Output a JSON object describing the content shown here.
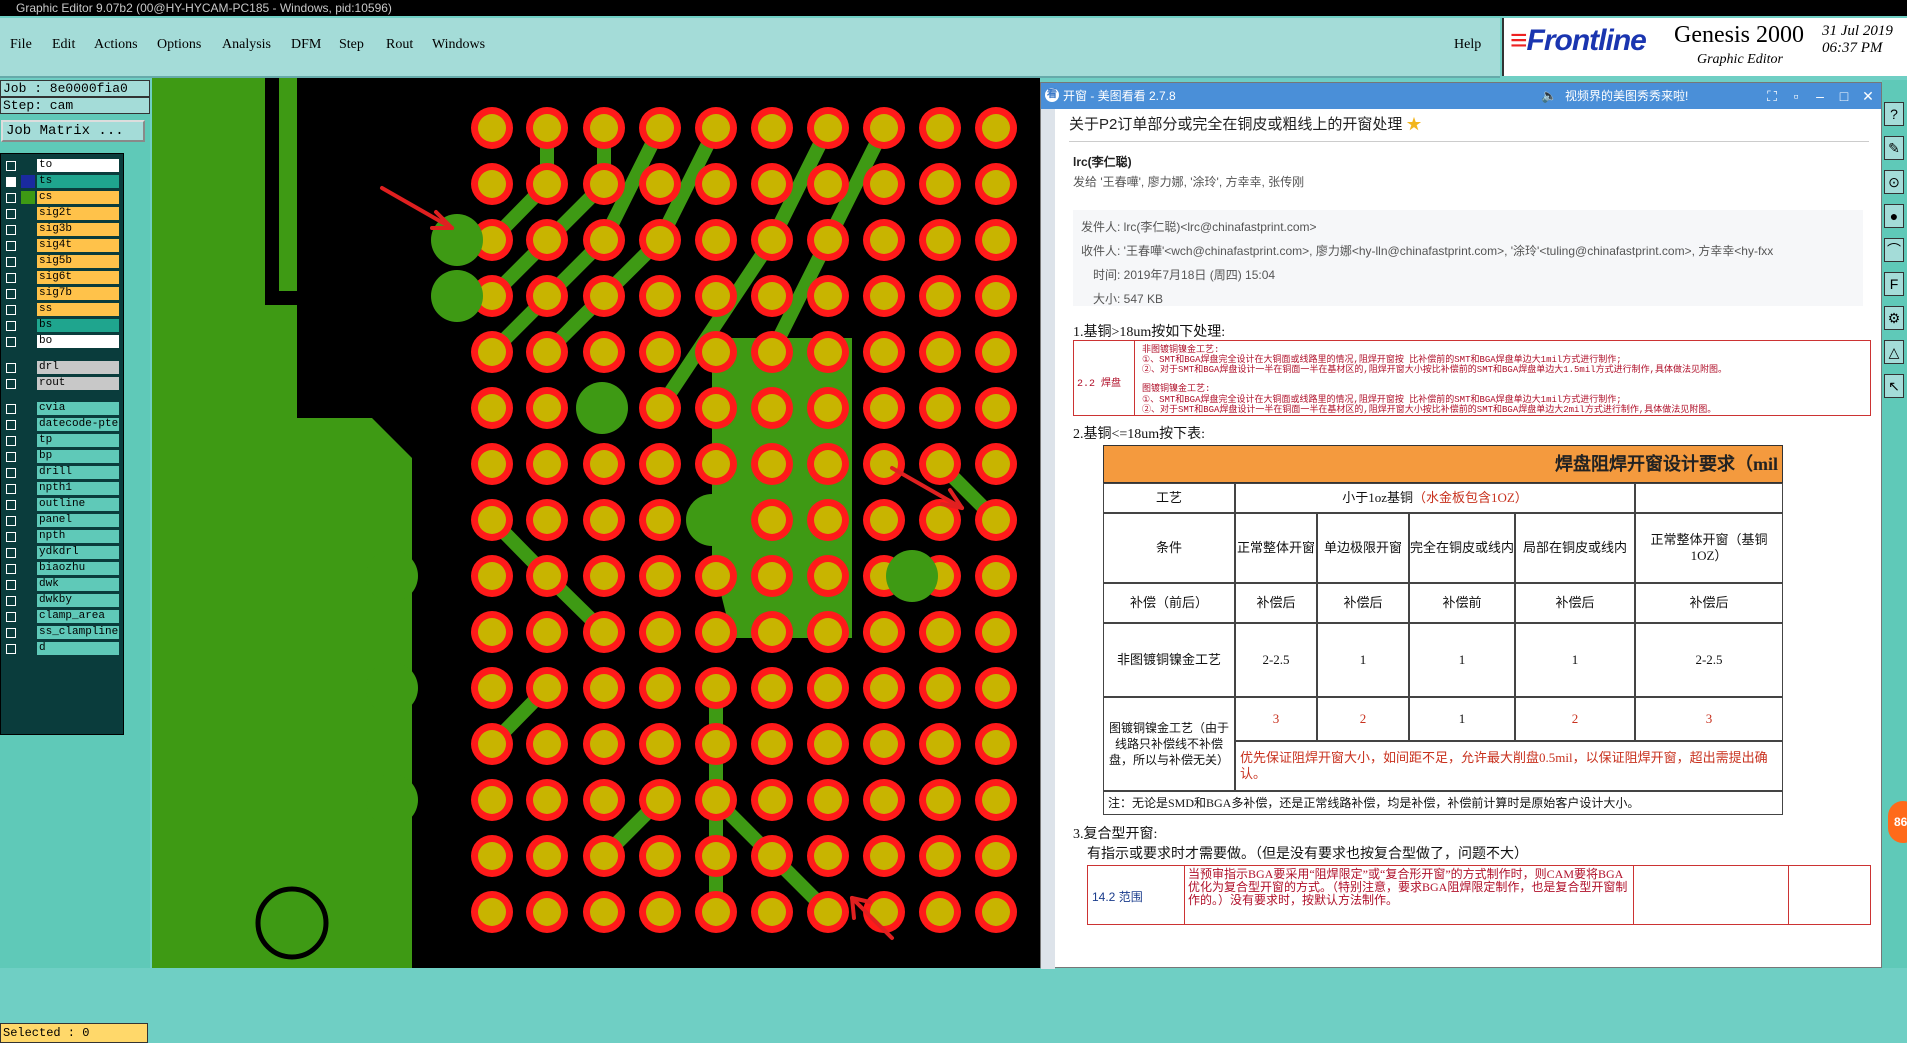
{
  "window_title": "Graphic Editor 9.07b2 (00@HY-HYCAM-PC185 - Windows, pid:10596)",
  "menu": [
    "File",
    "Edit",
    "Actions",
    "Options",
    "Analysis",
    "DFM",
    "Step",
    "Rout",
    "Windows"
  ],
  "help_label": "Help",
  "brand": {
    "logo": "Frontline",
    "product": "Genesis 2000",
    "subtitle": "Graphic Editor",
    "date": "31 Jul 2019",
    "time": "06:37 PM"
  },
  "job_label": "Job : 8e0000fia0",
  "step_label": "Step: cam",
  "job_matrix_label": "Job Matrix ...",
  "layers": [
    {
      "name": "to",
      "color": "#ffffff",
      "row": 0
    },
    {
      "name": "ts",
      "color": "#1fa58e",
      "row": 1
    },
    {
      "name": "cs",
      "color": "#ffc24a",
      "row": 2
    },
    {
      "name": "sig2t",
      "color": "#ffc24a",
      "row": 3
    },
    {
      "name": "sig3b",
      "color": "#ffc24a",
      "row": 4
    },
    {
      "name": "sig4t",
      "color": "#ffc24a",
      "row": 5
    },
    {
      "name": "sig5b",
      "color": "#ffc24a",
      "row": 6
    },
    {
      "name": "sig6t",
      "color": "#ffc24a",
      "row": 7
    },
    {
      "name": "sig7b",
      "color": "#ffc24a",
      "row": 8
    },
    {
      "name": "ss",
      "color": "#ffc24a",
      "row": 9
    },
    {
      "name": "bs",
      "color": "#1fa58e",
      "row": 10
    },
    {
      "name": "bo",
      "color": "#ffffff",
      "row": 11
    },
    {
      "name": "drl",
      "color": "#c8c8c8",
      "row": 12.6
    },
    {
      "name": "rout",
      "color": "#c8c8c8",
      "row": 13.6
    },
    {
      "name": "cvia",
      "color": "#5fc9b8",
      "row": 15.2
    },
    {
      "name": "datecode-pte",
      "color": "#5fc9b8",
      "row": 16.2
    },
    {
      "name": "tp",
      "color": "#5fc9b8",
      "row": 17.2
    },
    {
      "name": "bp",
      "color": "#5fc9b8",
      "row": 18.2
    },
    {
      "name": "drill",
      "color": "#5fc9b8",
      "row": 19.2
    },
    {
      "name": "npth1",
      "color": "#5fc9b8",
      "row": 20.2
    },
    {
      "name": "outline",
      "color": "#5fc9b8",
      "row": 21.2
    },
    {
      "name": "panel",
      "color": "#5fc9b8",
      "row": 22.2
    },
    {
      "name": "npth",
      "color": "#5fc9b8",
      "row": 23.2
    },
    {
      "name": "ydkdrl",
      "color": "#5fc9b8",
      "row": 24.2
    },
    {
      "name": "biaozhu",
      "color": "#5fc9b8",
      "row": 25.2
    },
    {
      "name": "dwk",
      "color": "#5fc9b8",
      "row": 26.2
    },
    {
      "name": "dwkby",
      "color": "#5fc9b8",
      "row": 27.2
    },
    {
      "name": "clamp_area",
      "color": "#5fc9b8",
      "row": 28.2
    },
    {
      "name": "ss_clampline",
      "color": "#5fc9b8",
      "row": 29.2
    },
    {
      "name": "d",
      "color": "#5fc9b8",
      "row": 30.2
    }
  ],
  "selected_label": "Selected : 0",
  "viewer": {
    "title": "开窗 - 美图看看 2.7.8",
    "promo": "视频界的美图秀秀来啦!",
    "subject": "关于P2订单部分或完全在铜皮或粗线上的开窗处理",
    "sender_name": "lrc(李仁聪)",
    "sent_to": "发给 '王春嘩', 廖力娜, '涂玲', 方幸幸, 张传刚",
    "from_line": "发件人: lrc(李仁聪)<lrc@chinafastprint.com>",
    "to_line": "收件人: '王春嘩'<wch@chinafastprint.com>, 廖力娜<hy-lln@chinafastprint.com>, '涂玲'<tuling@chinafastprint.com>, 方幸幸<hy-fxx",
    "time_line": "时间: 2019年7月18日 (周四) 15:04",
    "size_line": "大小: 547 KB",
    "sec1": "1.基铜>18um按如下处理:",
    "sec1_label": "2.2 焊盘",
    "sec1_lines": [
      "非图镀铜镍金工艺:",
      "①、SMT和BGA焊盘完全设计在大铜面或线路里的情况,阻焊开窗按 比补偿前的SMT和BGA焊盘单边大1mil方式进行制作;",
      "②、对于SMT和BGA焊盘设计一半在铜面一半在基材区的,阻焊开窗大小按比补偿前的SMT和BGA焊盘单边大1.5mil方式进行制作,具体做法见附图。",
      "图镀铜镍金工艺:",
      "①、SMT和BGA焊盘完全设计在大铜面或线路里的情况,阻焊开窗按 比补偿前的SMT和BGA焊盘单边大1mil方式进行制作;",
      "②、对于SMT和BGA焊盘设计一半在铜面一半在基材区的,阻焊开窗大小按比补偿前的SMT和BGA焊盘单边大2mil方式进行制作,具体做法见附图。"
    ],
    "sec2": "2.基铜<=18um按下表:",
    "table": {
      "title": "焊盘阻焊开窗设计要求（mil",
      "process_label": "工艺",
      "group_label": "小于1oz基铜",
      "group_note": "（水金板包含1OZ）",
      "cond_label": "条件",
      "cols": [
        "正常整体开窗",
        "单边极限开窗",
        "完全在铜皮或线内",
        "局部在铜皮或线内",
        "正常整体开窗（基铜1OZ）"
      ],
      "comp_label": "补偿（前后）",
      "comp": [
        "补偿后",
        "补偿后",
        "补偿前",
        "补偿后",
        "补偿后"
      ],
      "row1_label": "非图镀铜镍金工艺",
      "row1": [
        "2-2.5",
        "1",
        "1",
        "1",
        "2-2.5"
      ],
      "row2_label": "图镀铜镍金工艺（由于线路只补偿线不补偿盘，所以与补偿无关）",
      "row2": [
        "3",
        "2",
        "1",
        "2",
        "3"
      ],
      "row2_note": "优先保证阻焊开窗大小，如间距不足，允许最大削盘0.5mil，以保证阻焊开窗，超出需提出确认。",
      "footnote": "注：无论是SMD和BGA多补偿，还是正常线路补偿，均是补偿，补偿前计算时是原始客户设计大小。"
    },
    "sec3": "3.复合型开窗:",
    "sec3_sub": "有指示或要求时才需要做。（但是没有要求也按复合型做了，问题不大）",
    "sec3_label": "14.2 范围",
    "sec3_text": "当预审指示BGA要采用“阻焊限定”或“复合形开窗”的方式制作时，则CAM要将BGA优化为复合型开窗的方式。（特别注意，要求BGA阻焊限定制作，也是复合型开窗制作的。）没有要求时，按默认方法制作。"
  },
  "right_tools": [
    "?",
    "✎",
    "⊙",
    "●",
    "⌒",
    "F",
    "⚙",
    "△",
    "↖"
  ],
  "badge": "86",
  "colors": {
    "copper": "#3e9a14",
    "substrate": "#000000",
    "pad": "#ff1a1a",
    "solder_open": "#c8b400",
    "arrow": "#e02020"
  }
}
